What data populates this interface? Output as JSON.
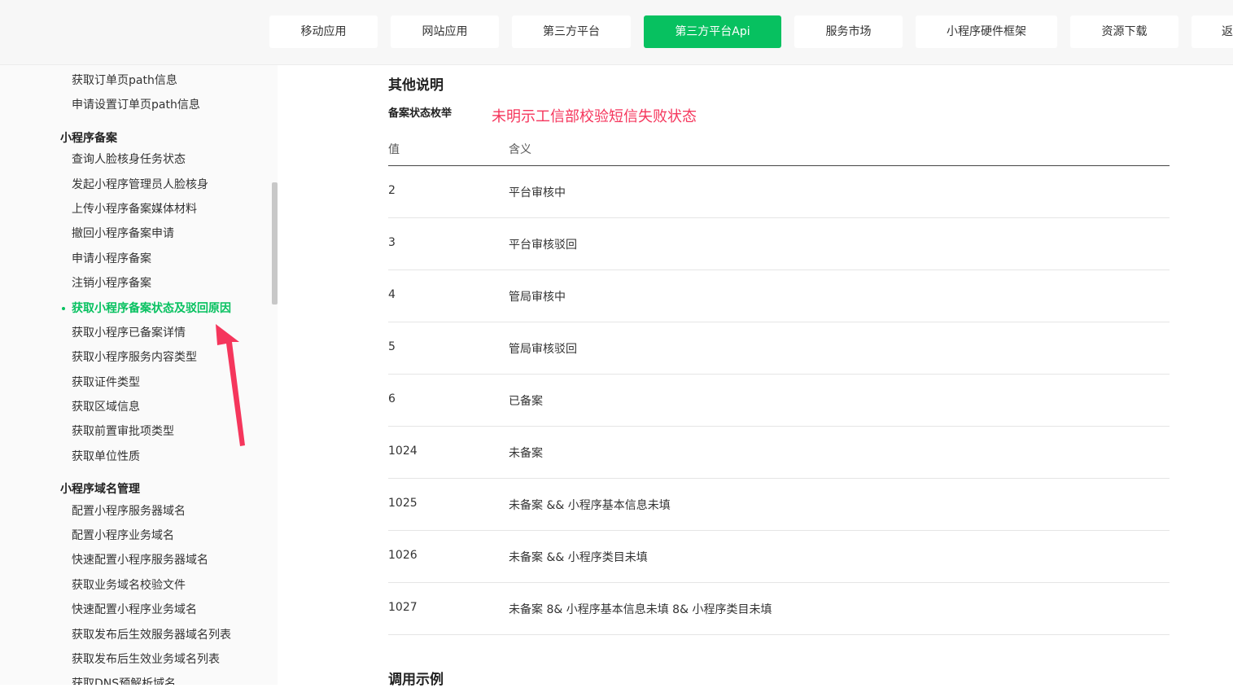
{
  "topnav": {
    "items": [
      {
        "label": "移动应用",
        "active": false
      },
      {
        "label": "网站应用",
        "active": false
      },
      {
        "label": "第三方平台",
        "active": false
      },
      {
        "label": "第三方平台Api",
        "active": true
      },
      {
        "label": "服务市场",
        "active": false
      },
      {
        "label": "小程序硬件框架",
        "active": false
      },
      {
        "label": "资源下载",
        "active": false
      },
      {
        "label": "返",
        "active": false
      }
    ]
  },
  "sidebar": {
    "group0": {
      "items": [
        "获取订单页path信息",
        "申请设置订单页path信息"
      ]
    },
    "group1": {
      "title": "小程序备案",
      "items": [
        "查询人脸核身任务状态",
        "发起小程序管理员人脸核身",
        "上传小程序备案媒体材料",
        "撤回小程序备案申请",
        "申请小程序备案",
        "注销小程序备案",
        "获取小程序备案状态及驳回原因",
        "获取小程序已备案详情",
        "获取小程序服务内容类型",
        "获取证件类型",
        "获取区域信息",
        "获取前置审批项类型",
        "获取单位性质"
      ],
      "active_item": "获取小程序备案状态及驳回原因"
    },
    "group2": {
      "title": "小程序域名管理",
      "items": [
        "配置小程序服务器域名",
        "配置小程序业务域名",
        "快速配置小程序服务器域名",
        "获取业务域名校验文件",
        "快速配置小程序业务域名",
        "获取发布后生效服务器域名列表",
        "获取发布后生效业务域名列表",
        "获取DNS预解析域名"
      ]
    }
  },
  "main": {
    "section_title": "其他说明",
    "sub_label": "备案状态枚举",
    "annotation": "未明示工信部校验短信失败状态",
    "table": {
      "headers": [
        "值",
        "含义"
      ],
      "rows": [
        [
          "2",
          "平台审核中"
        ],
        [
          "3",
          "平台审核驳回"
        ],
        [
          "4",
          "管局审核中"
        ],
        [
          "5",
          "管局审核驳回"
        ],
        [
          "6",
          "已备案"
        ],
        [
          "1024",
          "未备案"
        ],
        [
          "1025",
          "未备案 && 小程序基本信息未填"
        ],
        [
          "1026",
          "未备案 && 小程序类目未填"
        ],
        [
          "1027",
          "未备案 8& 小程序基本信息未填 8& 小程序类目未填"
        ]
      ]
    },
    "next_section_title": "调用示例"
  },
  "colors": {
    "accent": "#07c160",
    "annotation": "#f5365c",
    "arrow": "#f5365c"
  },
  "icons": {
    "arrow": "up-left-arrow-icon"
  }
}
